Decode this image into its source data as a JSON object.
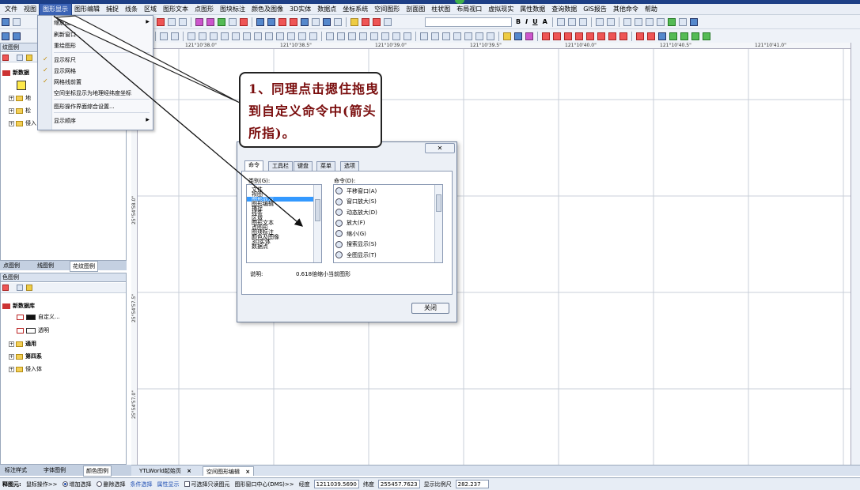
{
  "menubar": {
    "items": [
      "文件",
      "视图",
      "图形显示",
      "图形编辑",
      "捕捉",
      "线条",
      "区域",
      "图形文本",
      "点图形",
      "图块标注",
      "颜色及图像",
      "3D实体",
      "数据点",
      "坐标系统",
      "空间图形",
      "剖面图",
      "柱状图",
      "布局视口",
      "虚拟现实",
      "属性数据",
      "查询数据",
      "GIS报告",
      "其他命令",
      "帮助"
    ],
    "active_index": 2
  },
  "dropdown": {
    "items": [
      {
        "label": "缩放图形",
        "checked": false,
        "submenu": true
      },
      {
        "label": "刷新窗口",
        "checked": false,
        "submenu": false
      },
      {
        "label": "重绘图形",
        "checked": false,
        "submenu": false
      },
      {
        "label": "显示标尺",
        "checked": true,
        "submenu": false
      },
      {
        "label": "显示网格",
        "checked": true,
        "submenu": false
      },
      {
        "label": "网格线前置",
        "checked": true,
        "submenu": false
      },
      {
        "label": "空间坐标显示为地理经纬度坐标",
        "checked": false,
        "submenu": false
      },
      {
        "label": "图形操作界面综合设置...",
        "checked": false,
        "submenu": false
      },
      {
        "label": "显示顺序",
        "checked": false,
        "submenu": true
      }
    ]
  },
  "callout": {
    "text": "1、同理点击摁住拖曳到自定义命令中(箭头所指)。"
  },
  "dialog": {
    "close_x": "✕",
    "tabs": [
      "命令",
      "工具栏",
      "键盘",
      "菜单",
      "选项"
    ],
    "selected_tab": 0,
    "category_label": "类别(G):",
    "categories": [
      "文件",
      "视图",
      "图形显示",
      "图形编辑",
      "捕捉",
      "线条",
      "区域",
      "图形文本",
      "点图形",
      "图块标注",
      "颜色及图像",
      "3D实体",
      "数据点"
    ],
    "selected_category": 2,
    "command_label": "命令(D):",
    "commands": [
      "平移窗口(A)",
      "窗口放大(S)",
      "动态放大(D)",
      "放大(F)",
      "缩小(G)",
      "搜索显示(S)",
      "全图显示(T)"
    ],
    "description_label": "说明:",
    "description": "0.618倍缩小当前图形",
    "close_button": "关闭"
  },
  "ruler": {
    "top_labels": [
      "121°10'38.0\"",
      "121°10'38.5\"",
      "121°10'39.0\"",
      "121°10'39.5\"",
      "121°10'40.0\"",
      "121°10'40.5\"",
      "121°10'41.0\""
    ],
    "left_labels": [
      "25°54'58.0\"",
      "25°54'57.5\"",
      "25°54'57.0\""
    ]
  },
  "left_top_panel": {
    "title": "纹图例",
    "root": "新数据",
    "items": [
      "地",
      "松",
      "侵入"
    ]
  },
  "left_tabs": [
    "点图例",
    "线图例",
    "花纹图例"
  ],
  "left_bottom_panel": {
    "title": "色图例",
    "root": "新数据库",
    "items": [
      {
        "label": "自定义...",
        "color": "#111111"
      },
      {
        "label": "透明",
        "color": "#ffffff"
      }
    ],
    "folders": [
      "通用",
      "第四系",
      "侵入体"
    ]
  },
  "bottom_left_tabs": [
    "标注样式",
    "字体图例",
    "颜色图例"
  ],
  "doc_tabs": [
    "YTLWorld起始页",
    "空间图形编辑"
  ],
  "doc_tab_close": "×",
  "statusbar": {
    "label_main": "释图元:",
    "mouse_op": "鼠标操作>>",
    "add_select": "增加选择",
    "del_select": "删除选择",
    "cond_select": "条件选择",
    "attr_show": "属性显示",
    "readonly": "可选择只读图元",
    "center": "图形窗口中心(DMS)>>",
    "lon_label": "经度",
    "lon": "1211039.5690",
    "lat_label": "纬度",
    "lat": "255457.7623",
    "scale_label": "显示比例尺",
    "scale": "282.237"
  },
  "colors": {
    "menu_active": "#3b63b5",
    "callout_text": "#7a0d0d",
    "selection": "#3399ff"
  }
}
